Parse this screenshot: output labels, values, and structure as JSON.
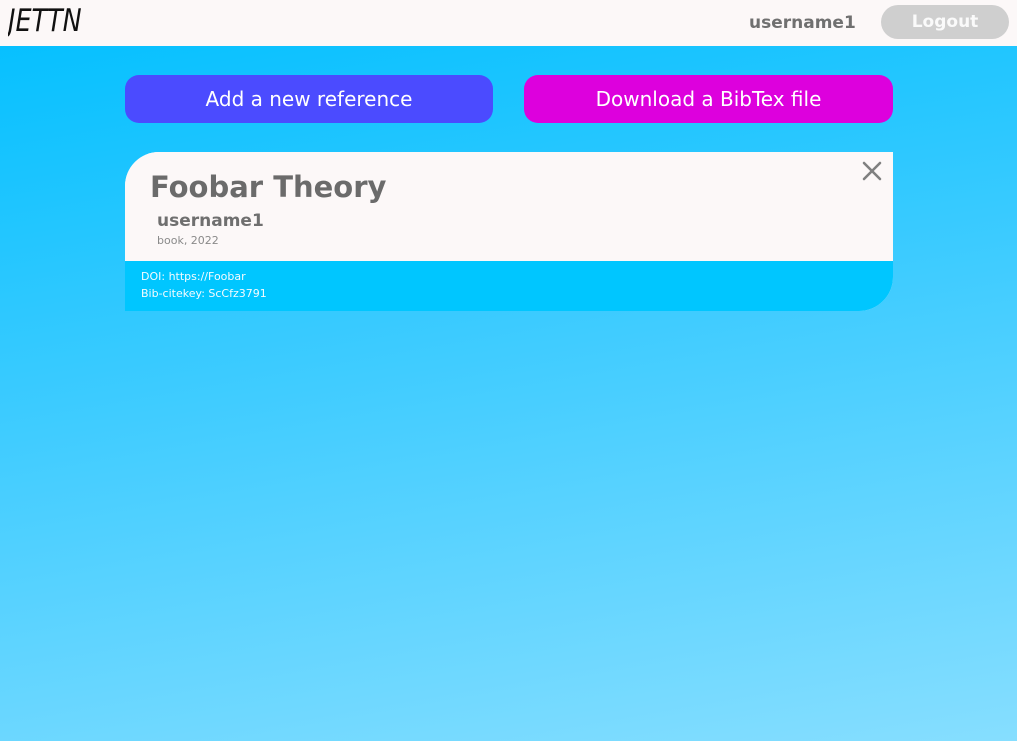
{
  "header": {
    "logo_text": "JETTN",
    "username": "username1",
    "logout_label": "Logout"
  },
  "actions": {
    "add_label": "Add a new reference",
    "download_label": "Download a BibTex file"
  },
  "colors": {
    "add_button": "#4b4bff",
    "download_button": "#dd00dd",
    "card_footer": "#00c6ff",
    "logout_button": "#cfcfcf"
  },
  "references": [
    {
      "title": "Foobar Theory",
      "author": "username1",
      "meta": "book, 2022",
      "doi": "DOI: https://Foobar",
      "citekey": "Bib-citekey: ScCfz3791",
      "close_icon": "close-icon"
    }
  ]
}
